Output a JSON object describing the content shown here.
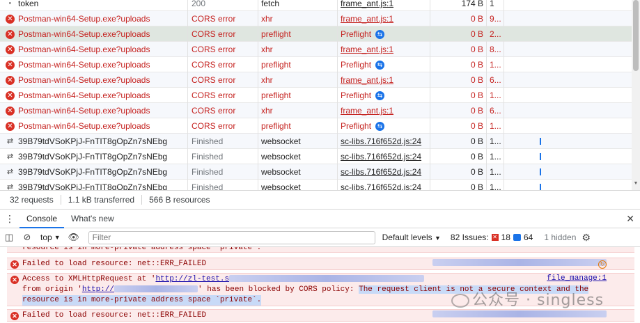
{
  "rows": [
    {
      "name": "token",
      "status": "200",
      "type": "fetch",
      "initiator": "frame_ant.js:1",
      "size": "174 B",
      "time": "1",
      "kind": "ok"
    },
    {
      "name": "Postman-win64-Setup.exe?uploads",
      "status": "CORS error",
      "type": "xhr",
      "initiator": "frame_ant.js:1",
      "size": "0 B",
      "time": "9...",
      "kind": "error"
    },
    {
      "name": "Postman-win64-Setup.exe?uploads",
      "status": "CORS error",
      "type": "preflight",
      "initiator": "Preflight",
      "size": "0 B",
      "time": "2...",
      "kind": "error-preflight",
      "selected": true
    },
    {
      "name": "Postman-win64-Setup.exe?uploads",
      "status": "CORS error",
      "type": "xhr",
      "initiator": "frame_ant.js:1",
      "size": "0 B",
      "time": "8...",
      "kind": "error"
    },
    {
      "name": "Postman-win64-Setup.exe?uploads",
      "status": "CORS error",
      "type": "preflight",
      "initiator": "Preflight",
      "size": "0 B",
      "time": "1...",
      "kind": "error-preflight"
    },
    {
      "name": "Postman-win64-Setup.exe?uploads",
      "status": "CORS error",
      "type": "xhr",
      "initiator": "frame_ant.js:1",
      "size": "0 B",
      "time": "6...",
      "kind": "error"
    },
    {
      "name": "Postman-win64-Setup.exe?uploads",
      "status": "CORS error",
      "type": "preflight",
      "initiator": "Preflight",
      "size": "0 B",
      "time": "1...",
      "kind": "error-preflight"
    },
    {
      "name": "Postman-win64-Setup.exe?uploads",
      "status": "CORS error",
      "type": "xhr",
      "initiator": "frame_ant.js:1",
      "size": "0 B",
      "time": "6...",
      "kind": "error"
    },
    {
      "name": "Postman-win64-Setup.exe?uploads",
      "status": "CORS error",
      "type": "preflight",
      "initiator": "Preflight",
      "size": "0 B",
      "time": "1...",
      "kind": "error-preflight"
    },
    {
      "name": "39B79tdVSoKPjJ-FnTIT8gOpZn7sNEbg",
      "status": "Finished",
      "type": "websocket",
      "initiator": "sc-libs.716f652d.js:24",
      "size": "0 B",
      "time": "1...",
      "kind": "ws"
    },
    {
      "name": "39B79tdVSoKPjJ-FnTIT8gOpZn7sNEbg",
      "status": "Finished",
      "type": "websocket",
      "initiator": "sc-libs.716f652d.js:24",
      "size": "0 B",
      "time": "1...",
      "kind": "ws"
    },
    {
      "name": "39B79tdVSoKPjJ-FnTIT8gOpZn7sNEbg",
      "status": "Finished",
      "type": "websocket",
      "initiator": "sc-libs.716f652d.js:24",
      "size": "0 B",
      "time": "1...",
      "kind": "ws"
    },
    {
      "name": "39B79tdVSoKPjJ-FnTIT8gOpZn7sNEbg",
      "status": "Finished",
      "type": "websocket",
      "initiator": "sc-libs.716f652d.js:24",
      "size": "0 B",
      "time": "1...",
      "kind": "ws"
    }
  ],
  "summary": {
    "requests": "32 requests",
    "transferred": "1.1 kB transferred",
    "resources": "566 B resources"
  },
  "drawer": {
    "tabs": [
      "Console",
      "What's new"
    ],
    "active_tab": "Console"
  },
  "toolbar": {
    "context": "top",
    "filter_placeholder": "Filter",
    "levels": "Default levels",
    "issues_label": "82 Issues:",
    "issues_errors": "18",
    "issues_info": "64",
    "hidden": "1 hidden"
  },
  "console": {
    "partial_line": "resource is in more-private address space `private`.",
    "msg1": "Failed to load resource: net::ERR_FAILED",
    "msg2_l1a": "Access to XMLHttpRequest at '",
    "msg2_url": "http://zl-test.s",
    "msg2_src": "file_manage:1",
    "msg2_l2a": "from origin '",
    "msg2_origin": "http://",
    "msg2_l2b": "' has been blocked by CORS policy: ",
    "msg2_l2c": "The request client is not a secure context and the",
    "msg2_l3": "resource is in more-private address space `private`.",
    "msg3": "Failed to load resource: net::ERR_FAILED"
  },
  "watermark": "公众号 · singless"
}
